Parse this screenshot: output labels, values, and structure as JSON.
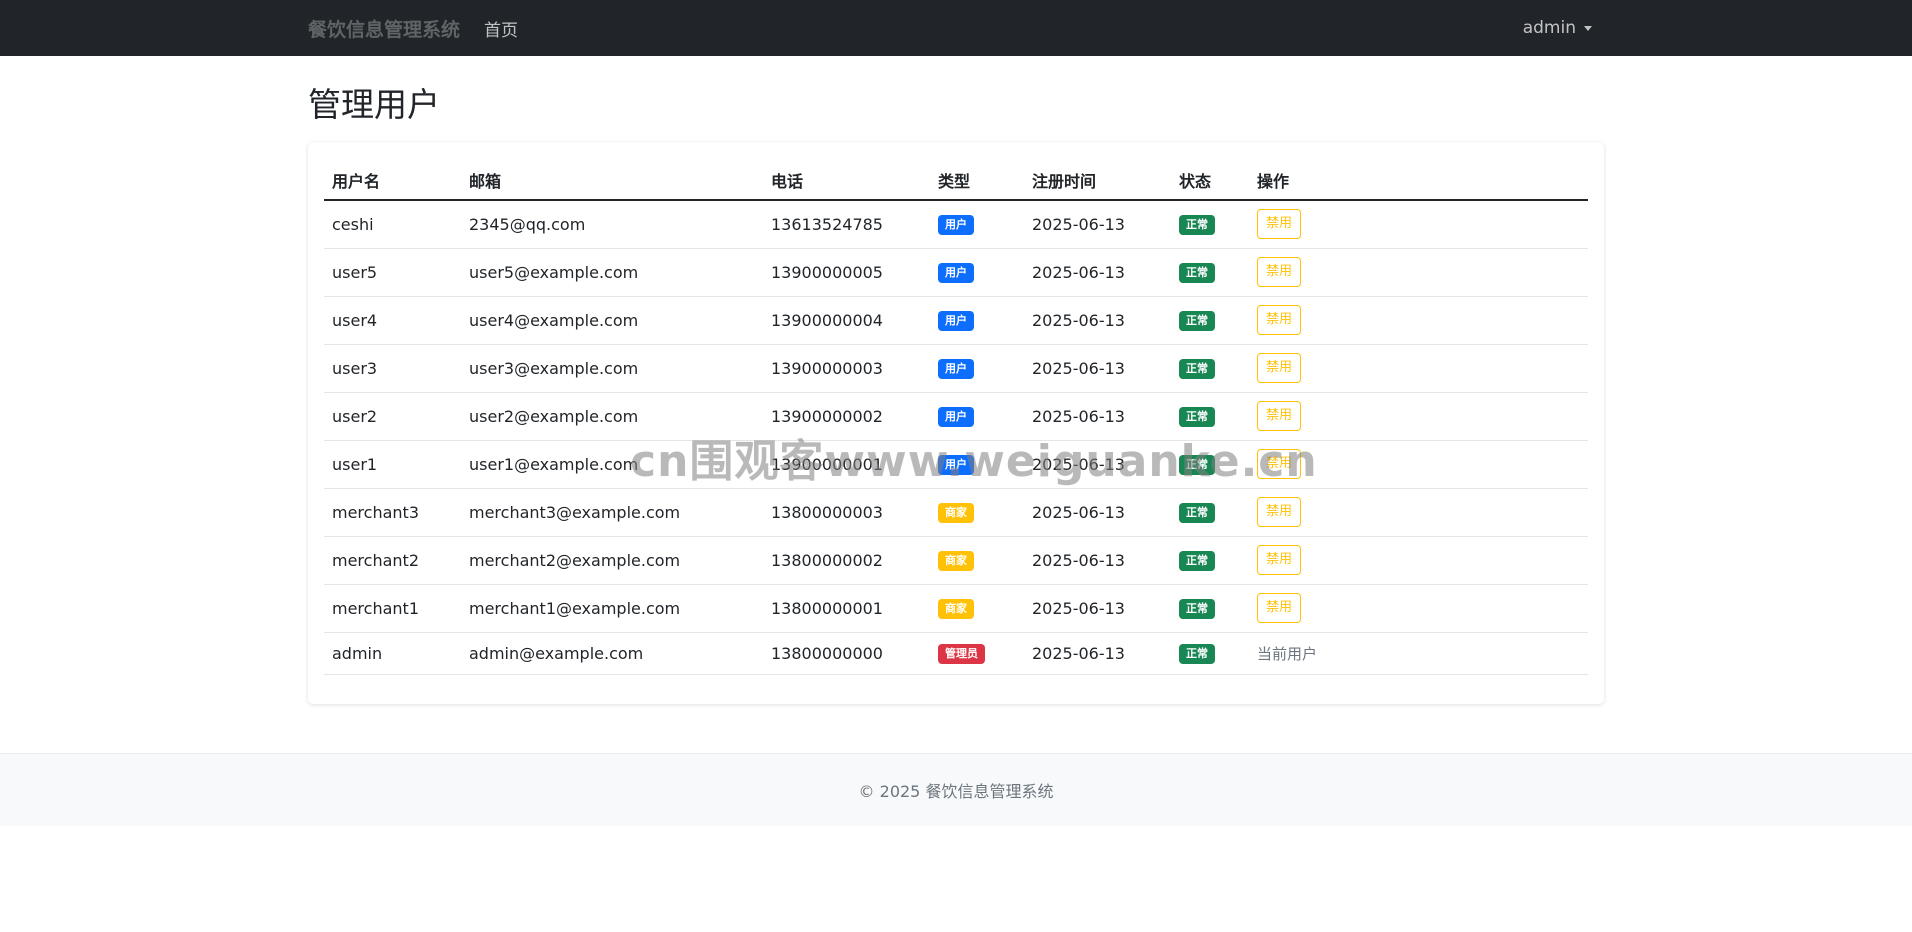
{
  "navbar": {
    "brand": "餐饮信息管理系统",
    "home": "首页",
    "user": "admin"
  },
  "page": {
    "title": "管理用户"
  },
  "table": {
    "headers": [
      "用户名",
      "邮箱",
      "电话",
      "类型",
      "注册时间",
      "状态",
      "操作"
    ],
    "rows": [
      {
        "username": "ceshi",
        "email": "2345@qq.com",
        "phone": "13613524785",
        "type": "用户",
        "date": "2025-06-13",
        "status": "正常",
        "action": "禁用"
      },
      {
        "username": "user5",
        "email": "user5@example.com",
        "phone": "13900000005",
        "type": "用户",
        "date": "2025-06-13",
        "status": "正常",
        "action": "禁用"
      },
      {
        "username": "user4",
        "email": "user4@example.com",
        "phone": "13900000004",
        "type": "用户",
        "date": "2025-06-13",
        "status": "正常",
        "action": "禁用"
      },
      {
        "username": "user3",
        "email": "user3@example.com",
        "phone": "13900000003",
        "type": "用户",
        "date": "2025-06-13",
        "status": "正常",
        "action": "禁用"
      },
      {
        "username": "user2",
        "email": "user2@example.com",
        "phone": "13900000002",
        "type": "用户",
        "date": "2025-06-13",
        "status": "正常",
        "action": "禁用"
      },
      {
        "username": "user1",
        "email": "user1@example.com",
        "phone": "13900000001",
        "type": "用户",
        "date": "2025-06-13",
        "status": "正常",
        "action": "禁用"
      },
      {
        "username": "merchant3",
        "email": "merchant3@example.com",
        "phone": "13800000003",
        "type": "商家",
        "date": "2025-06-13",
        "status": "正常",
        "action": "禁用"
      },
      {
        "username": "merchant2",
        "email": "merchant2@example.com",
        "phone": "13800000002",
        "type": "商家",
        "date": "2025-06-13",
        "status": "正常",
        "action": "禁用"
      },
      {
        "username": "merchant1",
        "email": "merchant1@example.com",
        "phone": "13800000001",
        "type": "商家",
        "date": "2025-06-13",
        "status": "正常",
        "action": "禁用"
      },
      {
        "username": "admin",
        "email": "admin@example.com",
        "phone": "13800000000",
        "type": "管理员",
        "date": "2025-06-13",
        "status": "正常",
        "action": "当前用户"
      }
    ]
  },
  "colors": {
    "navbar_bg": "#212529",
    "badge_user": "#0d6efd",
    "badge_merchant": "#ffc107",
    "badge_admin": "#dc3545",
    "badge_status": "#198754",
    "btn_warning": "#ffc107"
  },
  "footer": {
    "text": "© 2025 餐饮信息管理系统"
  },
  "watermark": {
    "text": "cn围观客www.weiguanke.cn"
  }
}
